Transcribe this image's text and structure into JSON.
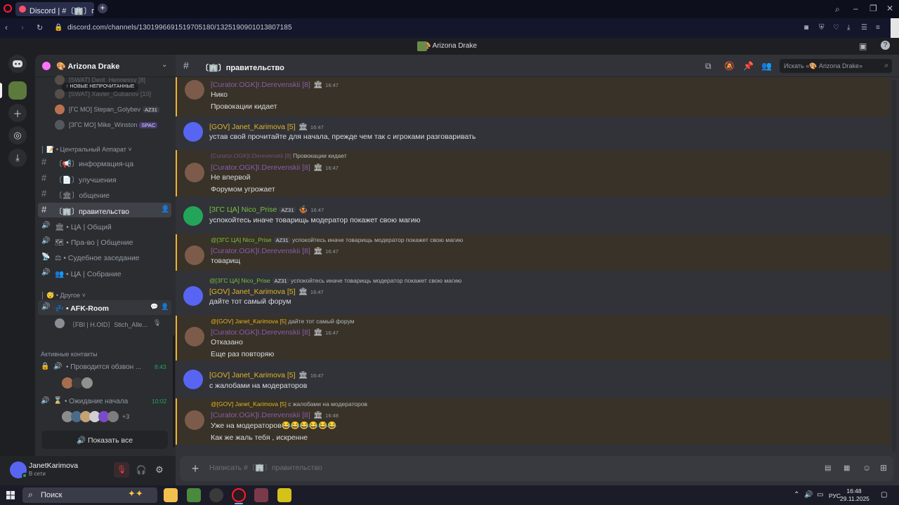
{
  "browser": {
    "tab_title": "Discord | #〔🏢〕правит",
    "url": "discord.com/channels/1301996691519705180/1325190901013807185"
  },
  "app": {
    "server_title": "🎨 Arizona Drake"
  },
  "guild": {
    "name": "🎨 Arizona Drake",
    "unread_pill": "↑ НОВЫЕ НЕПРОЧИТАННЫЕ",
    "members_top": [
      {
        "name": "[SWAT] Derit_Hennessy [8]"
      },
      {
        "name": "[SWAT] Xavier_Gubanov [10]"
      },
      {
        "name": "[ГС МО] Stepan_Golybev",
        "tag": "AZ31"
      },
      {
        "name": "[ЗГС МО] Mike_Winston",
        "tag": "SPAC"
      }
    ],
    "category_central": "│ 📝 • Центральный Аппарат ˅",
    "channels": [
      {
        "label": "〔📢〕информация-ца",
        "icon": "#"
      },
      {
        "label": "〔📄〕улучшения",
        "icon": "#"
      },
      {
        "label": "〔🏛〕общение",
        "icon": "#"
      },
      {
        "label": "〔🏢〕правительство",
        "icon": "#"
      },
      {
        "label": "🏛 • ЦА | Общий",
        "icon": "🔊"
      },
      {
        "label": "🗺 • Пра-во | Общение",
        "icon": "🔊"
      },
      {
        "label": "⚖ • Судебное заседание",
        "icon": "📡"
      },
      {
        "label": "👥 • ЦА | Собрание",
        "icon": "🔊"
      }
    ],
    "category_other": "│ 😴 • Другое ˅",
    "afk_channel": "💤 • AFK-Room",
    "afk_member": "〔FBI | H.OID〕Stich_Alle...",
    "active_title": "Активные контакты",
    "activity1": {
      "label": "• Проводится обзвон ...",
      "time": "8:43"
    },
    "activity2": {
      "label": "• Ожидание начала",
      "time": "10:02",
      "extra": "+3"
    },
    "show_all": "Показать все"
  },
  "user": {
    "name": "JanetKarimova",
    "status": "В сети"
  },
  "chat": {
    "channel_title": "〔🏢〕правительство",
    "search_placeholder": "Искать «🎨 Arizona Drake»",
    "composer_placeholder": "Написать #〔🏢〕правительство",
    "messages": [
      {
        "author": "[Curator.OGK]I.Derevenskii [8]",
        "time": "16:47",
        "lines": [
          "Нико",
          "Провокации кидает"
        ]
      },
      {
        "author": "[GOV] Janet_Karimova [5]",
        "time": "16:47",
        "lines": [
          "устав свой прочитайте для начала, прежде чем так с игроками разговаривать"
        ]
      },
      {
        "reply_author": "[Curator.OGK]I.Derevenskii [8]",
        "reply_text": "Провокации кидает",
        "author": "[Curator.OGK]I.Derevenskii [8]",
        "time": "16:47",
        "lines": [
          "Не впервой",
          "Форумом угрожает"
        ]
      },
      {
        "author": "[ЗГС ЦА] Nico_Prise",
        "tag": "AZ31",
        "time": "16:47",
        "lines": [
          "успокойтесь иначе товарищь модератор покажет свою магию"
        ]
      },
      {
        "reply_author": "@[ЗГС ЦА] Nico_Prise",
        "reply_tag": "AZ31",
        "reply_text": "успокойтесь иначе товарищь модератор покажет свою магию",
        "author": "[Curator.OGK]I.Derevenskii [8]",
        "time": "16:47",
        "lines": [
          "товарищ"
        ]
      },
      {
        "reply_author": "@[ЗГС ЦА] Nico_Prise",
        "reply_tag": "AZ31",
        "reply_text": "успокойтесь иначе товарищь модератор покажет свою магию",
        "author": "[GOV] Janet_Karimova [5]",
        "time": "16:47",
        "lines": [
          "дайте тот самый форум"
        ]
      },
      {
        "reply_author": "@[GOV] Janet_Karimova [5]",
        "reply_text": "дайте тот самый форум",
        "author": "[Curator.OGK]I.Derevenskii [8]",
        "time": "16:47",
        "lines": [
          "Отказано",
          "Еще раз повторяю"
        ]
      },
      {
        "author": "[GOV] Janet_Karimova [5]",
        "time": "16:47",
        "lines": [
          "с жалобами на модераторов"
        ]
      },
      {
        "reply_author": "@[GOV] Janet_Karimova [5]",
        "reply_text": "с жалобами на модераторов",
        "author": "[Curator.OGK]I.Derevenskii [8]",
        "time": "16:48",
        "lines": [
          "Уже на модераторов😂😂😂😂😂😂",
          "Как же жаль тебя , искренне"
        ]
      }
    ]
  },
  "taskbar": {
    "search_label": "Поиск",
    "lang": "РУС",
    "time": "16:48",
    "date": "29.11.2025"
  },
  "colors": {
    "accent": "#5865f2",
    "curator_name": "#8a5cad",
    "gov_name": "#e3b422",
    "zgs_name": "#7bc043",
    "mention_highlight": "#f0b232"
  }
}
